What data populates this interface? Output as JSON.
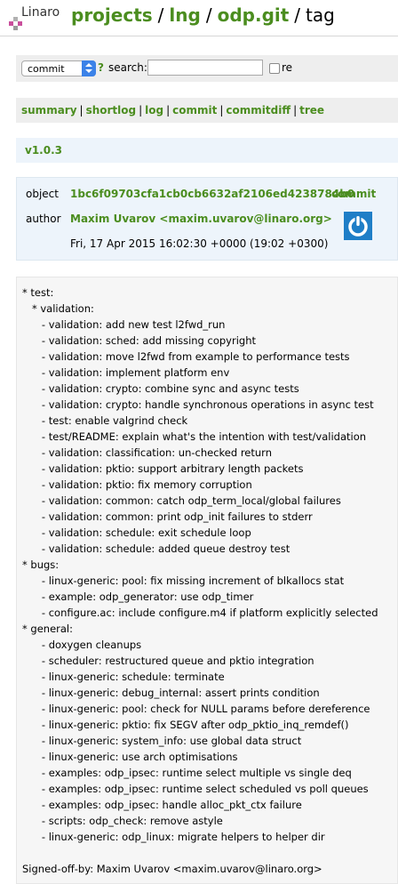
{
  "header": {
    "logo_text": "Linaro",
    "crumbs": [
      "projects",
      "lng",
      "odp.git"
    ],
    "current": "tag"
  },
  "search": {
    "select_value": "commit",
    "help": "?",
    "label": "search:",
    "input_value": "",
    "re_label": "re"
  },
  "nav": [
    "summary",
    "shortlog",
    "log",
    "commit",
    "commitdiff",
    "tree"
  ],
  "tag": {
    "name": "v1.0.3",
    "object_label": "object",
    "object_sha": "1bc6f09703cfa1cb0cb6632af2106ed4238784b0",
    "object_link": "commit",
    "author_label": "author",
    "author": "Maxim Uvarov <maxim.uvarov@linaro.org>",
    "date": "Fri, 17 Apr 2015 16:02:30 +0000 (19:02 +0300)"
  },
  "message": [
    "* test:",
    "   * validation:",
    "      - validation: add new test l2fwd_run",
    "      - validation: sched: add missing copyright",
    "      - validation: move l2fwd from example to performance tests",
    "      - validation: implement platform env",
    "      - validation: crypto: combine sync and async tests",
    "      - validation: crypto: handle synchronous operations in async test",
    "      - test: enable valgrind check",
    "      - test/README: explain what's the intention with test/validation",
    "      - validation: classification: un-checked return",
    "      - validation: pktio: support arbitrary length packets",
    "      - validation: pktio: fix memory corruption",
    "      - validation: common: catch odp_term_local/global failures",
    "      - validation: common: print odp_init failures to stderr",
    "      - validation: schedule: exit schedule loop",
    "      - validation: schedule: added queue destroy test",
    "* bugs:",
    "      - linux-generic: pool: fix missing increment of blkallocs stat",
    "      - example: odp_generator: use odp_timer",
    "      - configure.ac: include configure.m4 if platform explicitly selected",
    "* general:",
    "      - doxygen cleanups",
    "      - scheduler: restructured queue and pktio integration",
    "      - linux-generic: schedule: terminate",
    "      - linux-generic: debug_internal: assert prints condition",
    "      - linux-generic: pool: check for NULL params before dereference",
    "      - linux-generic: pktio: fix SEGV after odp_pktio_inq_remdef()",
    "      - linux-generic: system_info: use global data struct",
    "      - linux-generic: use arch optimisations",
    "      - examples: odp_ipsec: runtime select multiple vs single deq",
    "      - examples: odp_ipsec: runtime select scheduled vs poll queues",
    "      - examples: odp_ipsec: handle alloc_pkt_ctx failure",
    "      - scripts: odp_check: remove astyle",
    "      - linux-generic: odp_linux: migrate helpers to helper dir",
    "",
    "Signed-off-by: Maxim Uvarov <maxim.uvarov@linaro.org>"
  ],
  "colors": {
    "link": "#4b8d1f",
    "panel": "#eeeeee",
    "tag_panel": "#edf4fb",
    "avatar": "#1f7ec7"
  }
}
